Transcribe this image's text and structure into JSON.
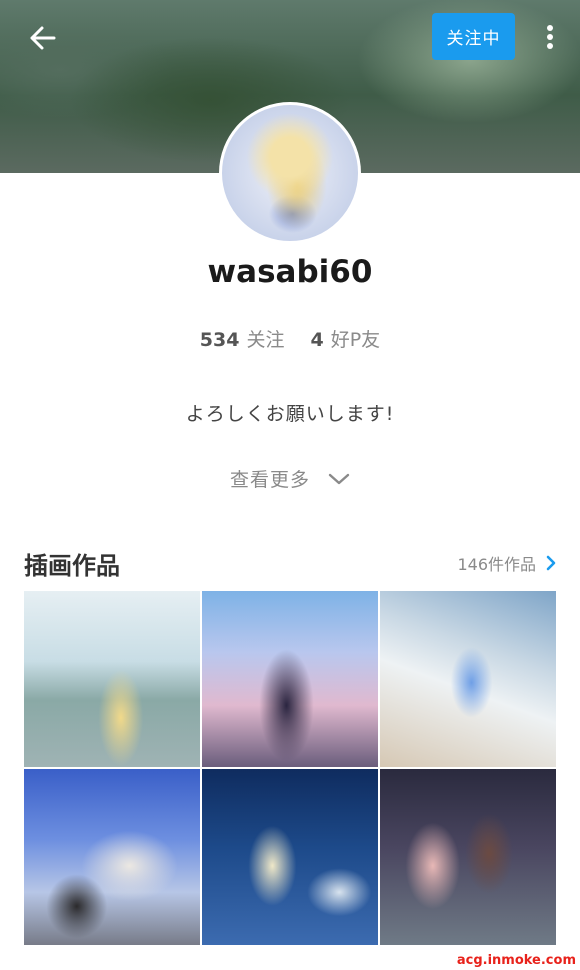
{
  "header": {
    "back_icon": "arrow-left-icon",
    "follow_label": "关注中",
    "follow_color": "#1a9bee",
    "more_icon": "more-vertical-icon"
  },
  "profile": {
    "username": "wasabi60",
    "following_count": "534",
    "following_label": "关注",
    "friends_count": "4",
    "friends_label": "好P友",
    "bio": "よろしくお願いします!",
    "see_more_label": "查看更多",
    "see_more_icon": "chevron-down-icon"
  },
  "illustrations": {
    "title": "插画作品",
    "count_label": "146件作品",
    "count_icon": "chevron-right-icon",
    "thumbnail_count": 6
  },
  "watermark": "acg.inmoke.com"
}
